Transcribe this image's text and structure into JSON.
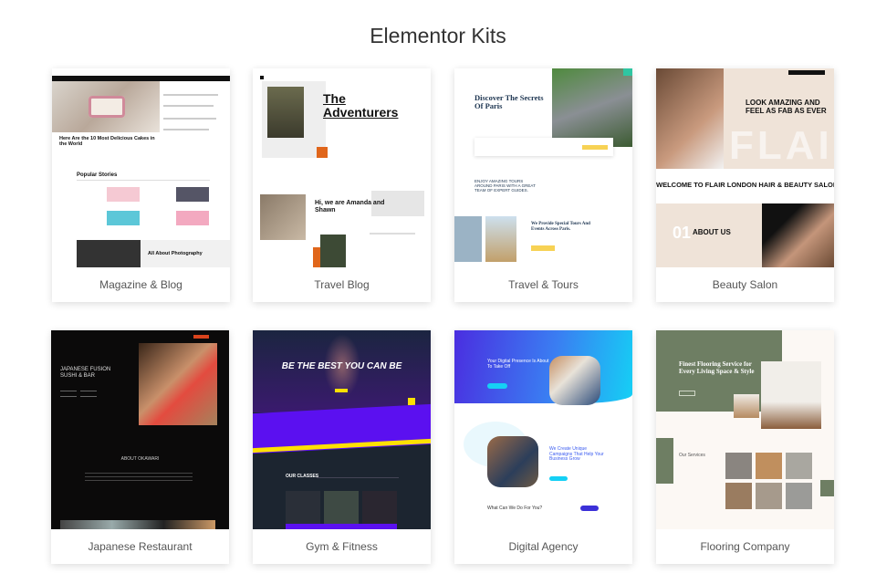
{
  "page_title": "Elementor Kits",
  "kits": [
    {
      "label": "Magazine & Blog",
      "headline": "Here Are the 10 Most Delicious Cakes in the World",
      "section": "Popular Stories",
      "feature": "All About Photography"
    },
    {
      "label": "Travel Blog",
      "headline": "The Adventurers",
      "intro": "Hi, we are Amanda and Shawn"
    },
    {
      "label": "Travel & Tours",
      "headline": "Discover The Secrets Of Paris",
      "subhead": "ENJOY AMAZING TOURS AROUND PARIS WITH A GREAT TEAM OF EXPERT GUIDES.",
      "section": "We Provide Special Tours And Events Across Paris."
    },
    {
      "label": "Beauty Salon",
      "headline": "LOOK AMAZING AND FEEL AS FAB AS EVER",
      "watermark": "FLAIR",
      "banner": "WELCOME TO FLAIR LONDON HAIR & BEAUTY SALON",
      "section": "ABOUT US",
      "number": "01"
    },
    {
      "label": "Japanese Restaurant",
      "headline": "JAPANESE FUSION SUSHI & BAR",
      "section": "ABOUT OKAWARI"
    },
    {
      "label": "Gym & Fitness",
      "headline": "BE THE BEST YOU CAN BE",
      "section": "OUR CLASSES"
    },
    {
      "label": "Digital Agency",
      "headline": "Your Digital Presence Is About To Take Off",
      "section": "We Create Unique Campaigns That Help Your Business Grow",
      "question": "What Can We Do For You?"
    },
    {
      "label": "Flooring Company",
      "headline": "Finest Flooring Service for Every Living Space & Style",
      "section": "Our Services"
    }
  ],
  "colors": {
    "accent_orange": "#e0661b",
    "gym_purple": "#5b10f0",
    "gym_yellow": "#ffe100",
    "agency_blue": "#3b5cf0",
    "floor_green": "#6e7e63"
  }
}
